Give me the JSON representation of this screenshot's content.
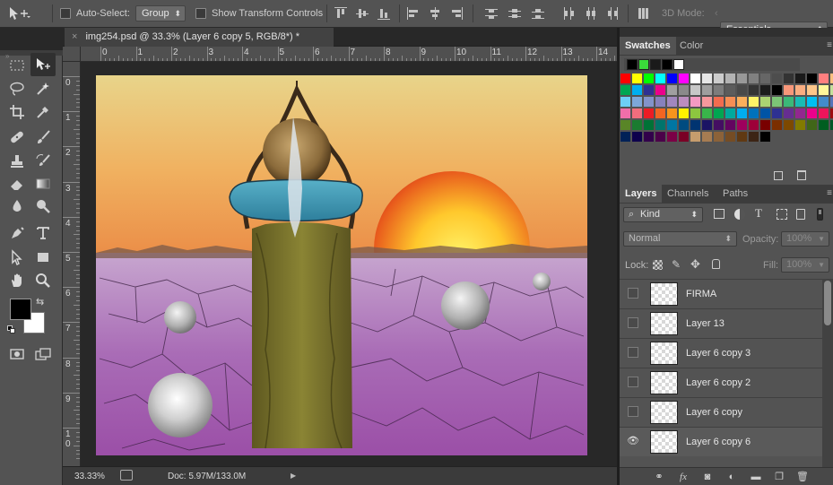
{
  "options_bar": {
    "auto_select_label": "Auto-Select:",
    "auto_select_value": "Group",
    "show_transform_label": "Show Transform Controls",
    "mode_3d_label": "3D Mode:",
    "workspace_value": "Essentials"
  },
  "document": {
    "tab_title": "img254.psd @ 33.3% (Layer 6 copy 5, RGB/8*) *",
    "tab_close": "×"
  },
  "ruler": {
    "horizontal": [
      "0",
      "1",
      "2",
      "3",
      "4",
      "5",
      "6",
      "7",
      "8",
      "9",
      "10",
      "11",
      "12",
      "13",
      "14"
    ],
    "vertical": [
      "0",
      "1",
      "2",
      "3",
      "4",
      "5",
      "6",
      "7",
      "8",
      "9",
      "1\n0"
    ]
  },
  "status": {
    "zoom": "33.33%",
    "doc_info": "Doc: 5.97M/133.0M",
    "expand_arrow": "▶"
  },
  "swatches_panel": {
    "tabs": [
      "Swatches",
      "Color"
    ],
    "top_colors": [
      "#000000",
      "#3adb3a",
      "#1a1a1a",
      "#000000",
      "#ffffff"
    ],
    "grid": [
      [
        "#ff0000",
        "#ffff00",
        "#00ff00",
        "#00ffff",
        "#0000ff",
        "#ff00ff",
        "#ffffff",
        "#e5e5e5",
        "#cccccc",
        "#b3b3b3",
        "#999999",
        "#808080",
        "#666666",
        "#4d4d4d",
        "#333333",
        "#1a1a1a",
        "#000000",
        "#ff7f7f",
        "#ffbf7f",
        "#ffff7f",
        "#ff0000",
        "#ffff00"
      ],
      [
        "#00a651",
        "#00aeef",
        "#2e3192",
        "#ec008c",
        "#a0a0a0",
        "#8a8a8a",
        "#c7c7c7",
        "#9e9e9e",
        "#7c7c7c",
        "#5c5c5c",
        "#494949",
        "#343434",
        "#1c1c1c",
        "#000000",
        "#f7977a",
        "#f9ad81",
        "#fdc68a",
        "#fff79a",
        "#c4df9b",
        "#a3d39c",
        "#82ca9d",
        "#7bcdc8"
      ],
      [
        "#6dcff6",
        "#7da7d9",
        "#8393ca",
        "#8781bd",
        "#a187be",
        "#bc8dbf",
        "#f49ac2",
        "#f6989d",
        "#f26c4f",
        "#f68e55",
        "#fbaf5c",
        "#fff467",
        "#acd372",
        "#7cc576",
        "#3bb878",
        "#1abbb4",
        "#00bff3",
        "#438ccb",
        "#5574b9",
        "#605ca8",
        "#855fa8",
        "#a763a8"
      ],
      [
        "#f06eaa",
        "#f26d7d",
        "#ed1c24",
        "#f26522",
        "#f7941d",
        "#fff200",
        "#8dc63f",
        "#39b54a",
        "#00a651",
        "#00a99d",
        "#00aeef",
        "#0072bc",
        "#0054a6",
        "#2e3192",
        "#662d91",
        "#92278f",
        "#ec008c",
        "#ed145b",
        "#9e0b0f",
        "#a0410d",
        "#a36209",
        "#aba000"
      ],
      [
        "#598527",
        "#1a7b30",
        "#007236",
        "#00746b",
        "#0076a3",
        "#004b80",
        "#003471",
        "#1b1464",
        "#440e62",
        "#630460",
        "#9e005d",
        "#9e0039",
        "#790000",
        "#7b2e00",
        "#7d4900",
        "#827b00",
        "#406618",
        "#005e20",
        "#005826",
        "#005952",
        "#005b7f",
        "#003663"
      ],
      [
        "#002157",
        "#0d004c",
        "#32004b",
        "#4b0049",
        "#7b0046",
        "#7a0026",
        "#c69c6d",
        "#a67c52",
        "#8c6239",
        "#754c24",
        "#603913",
        "#3c2415",
        "#000000"
      ]
    ]
  },
  "layers_panel": {
    "tabs": [
      "Layers",
      "Channels",
      "Paths"
    ],
    "kind_label": "Kind",
    "blend_mode": "Normal",
    "opacity_label": "Opacity:",
    "opacity_value": "100%",
    "lock_label": "Lock:",
    "fill_label": "Fill:",
    "fill_value": "100%",
    "layers": [
      {
        "name": "FIRMA",
        "visible": false
      },
      {
        "name": "Layer 13",
        "visible": false
      },
      {
        "name": "Layer 6 copy 3",
        "visible": false
      },
      {
        "name": "Layer 6 copy 2",
        "visible": false
      },
      {
        "name": "Layer 6 copy",
        "visible": false
      },
      {
        "name": "Layer 6 copy 6",
        "visible": true
      }
    ]
  },
  "tools": [
    "move-tool",
    "marquee-tool",
    "lasso-tool",
    "magic-wand-tool",
    "crop-tool",
    "eyedropper-tool",
    "healing-brush-tool",
    "brush-tool",
    "clone-stamp-tool",
    "history-brush-tool",
    "eraser-tool",
    "gradient-tool",
    "blur-tool",
    "dodge-tool",
    "pen-tool",
    "type-tool",
    "path-selection-tool",
    "rectangle-tool",
    "hand-tool",
    "zoom-tool"
  ],
  "colors": {
    "foreground": "#000000",
    "background": "#ffffff"
  }
}
